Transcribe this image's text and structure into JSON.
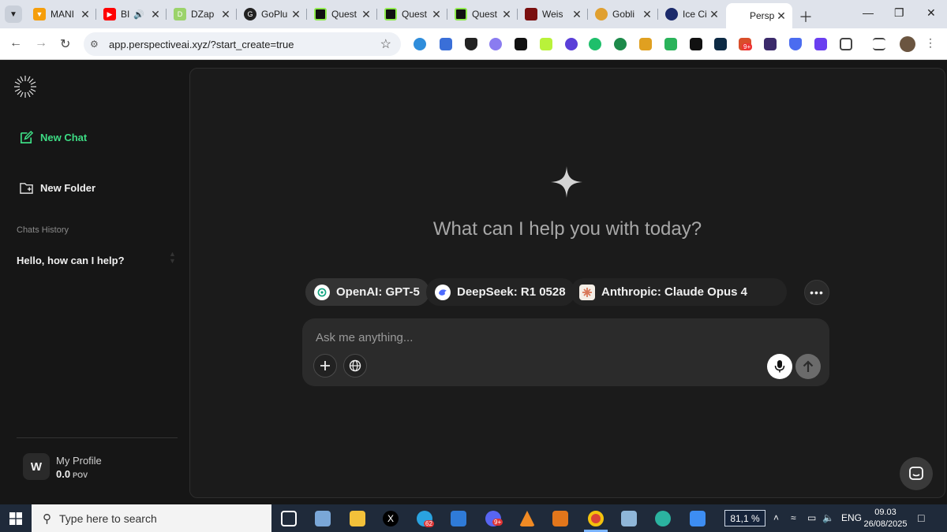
{
  "browser": {
    "tabs": [
      {
        "title": "MANI",
        "favicon_color": "#f59e0b",
        "icon": "mani-icon"
      },
      {
        "title": "BI",
        "favicon_color": "#ff0000",
        "icon": "youtube-icon",
        "audio": true
      },
      {
        "title": "DZap",
        "favicon_color": "#9bd36a",
        "icon": "dzap-icon"
      },
      {
        "title": "GoPlu",
        "favicon_color": "#222222",
        "icon": "goplus-icon"
      },
      {
        "title": "Quest",
        "favicon_color": "#111111",
        "icon": "quest-icon"
      },
      {
        "title": "Quest",
        "favicon_color": "#111111",
        "icon": "quest-icon"
      },
      {
        "title": "Quest",
        "favicon_color": "#111111",
        "icon": "quest-icon"
      },
      {
        "title": "Weis",
        "favicon_color": "#7a0f0f",
        "icon": "weis-icon"
      },
      {
        "title": "Gobli",
        "favicon_color": "#e0a030",
        "icon": "goblin-icon"
      },
      {
        "title": "Ice Ci",
        "favicon_color": "#1b2a6b",
        "icon": "ice-icon"
      },
      {
        "title": "Persp",
        "favicon_color": "#ffffff",
        "icon": "perspective-icon",
        "active": true
      }
    ],
    "url": "app.perspectiveai.xyz/?start_create=true",
    "extension_badge": "9+"
  },
  "sidebar": {
    "new_chat": "New Chat",
    "new_folder": "New Folder",
    "history_heading": "Chats History",
    "history_items": [
      "Hello, how can I help?"
    ],
    "profile": {
      "initial": "W",
      "name": "My Profile",
      "balance": "0.0",
      "unit": "POV"
    }
  },
  "main": {
    "headline": "What can I help you with today?",
    "models": [
      {
        "label": "OpenAI: GPT-5",
        "icon": "openai-icon",
        "selected": true
      },
      {
        "label": "DeepSeek: R1 0528",
        "icon": "deepseek-icon",
        "selected": false
      },
      {
        "label": "Anthropic: Claude Opus 4",
        "icon": "anthropic-icon",
        "selected": false
      }
    ],
    "composer": {
      "placeholder": "Ask me anything...",
      "value": ""
    }
  },
  "taskbar": {
    "search_placeholder": "Type here to search",
    "telegram_badge": "62",
    "discord_badge": "9+",
    "zoom": "81,1 %",
    "language": "ENG",
    "time": "09.03",
    "date": "26/08/2025"
  },
  "colors": {
    "accent": "#3ddc84",
    "background": "#161616",
    "panel": "#1b1b1b",
    "composer": "#2b2b2b"
  }
}
